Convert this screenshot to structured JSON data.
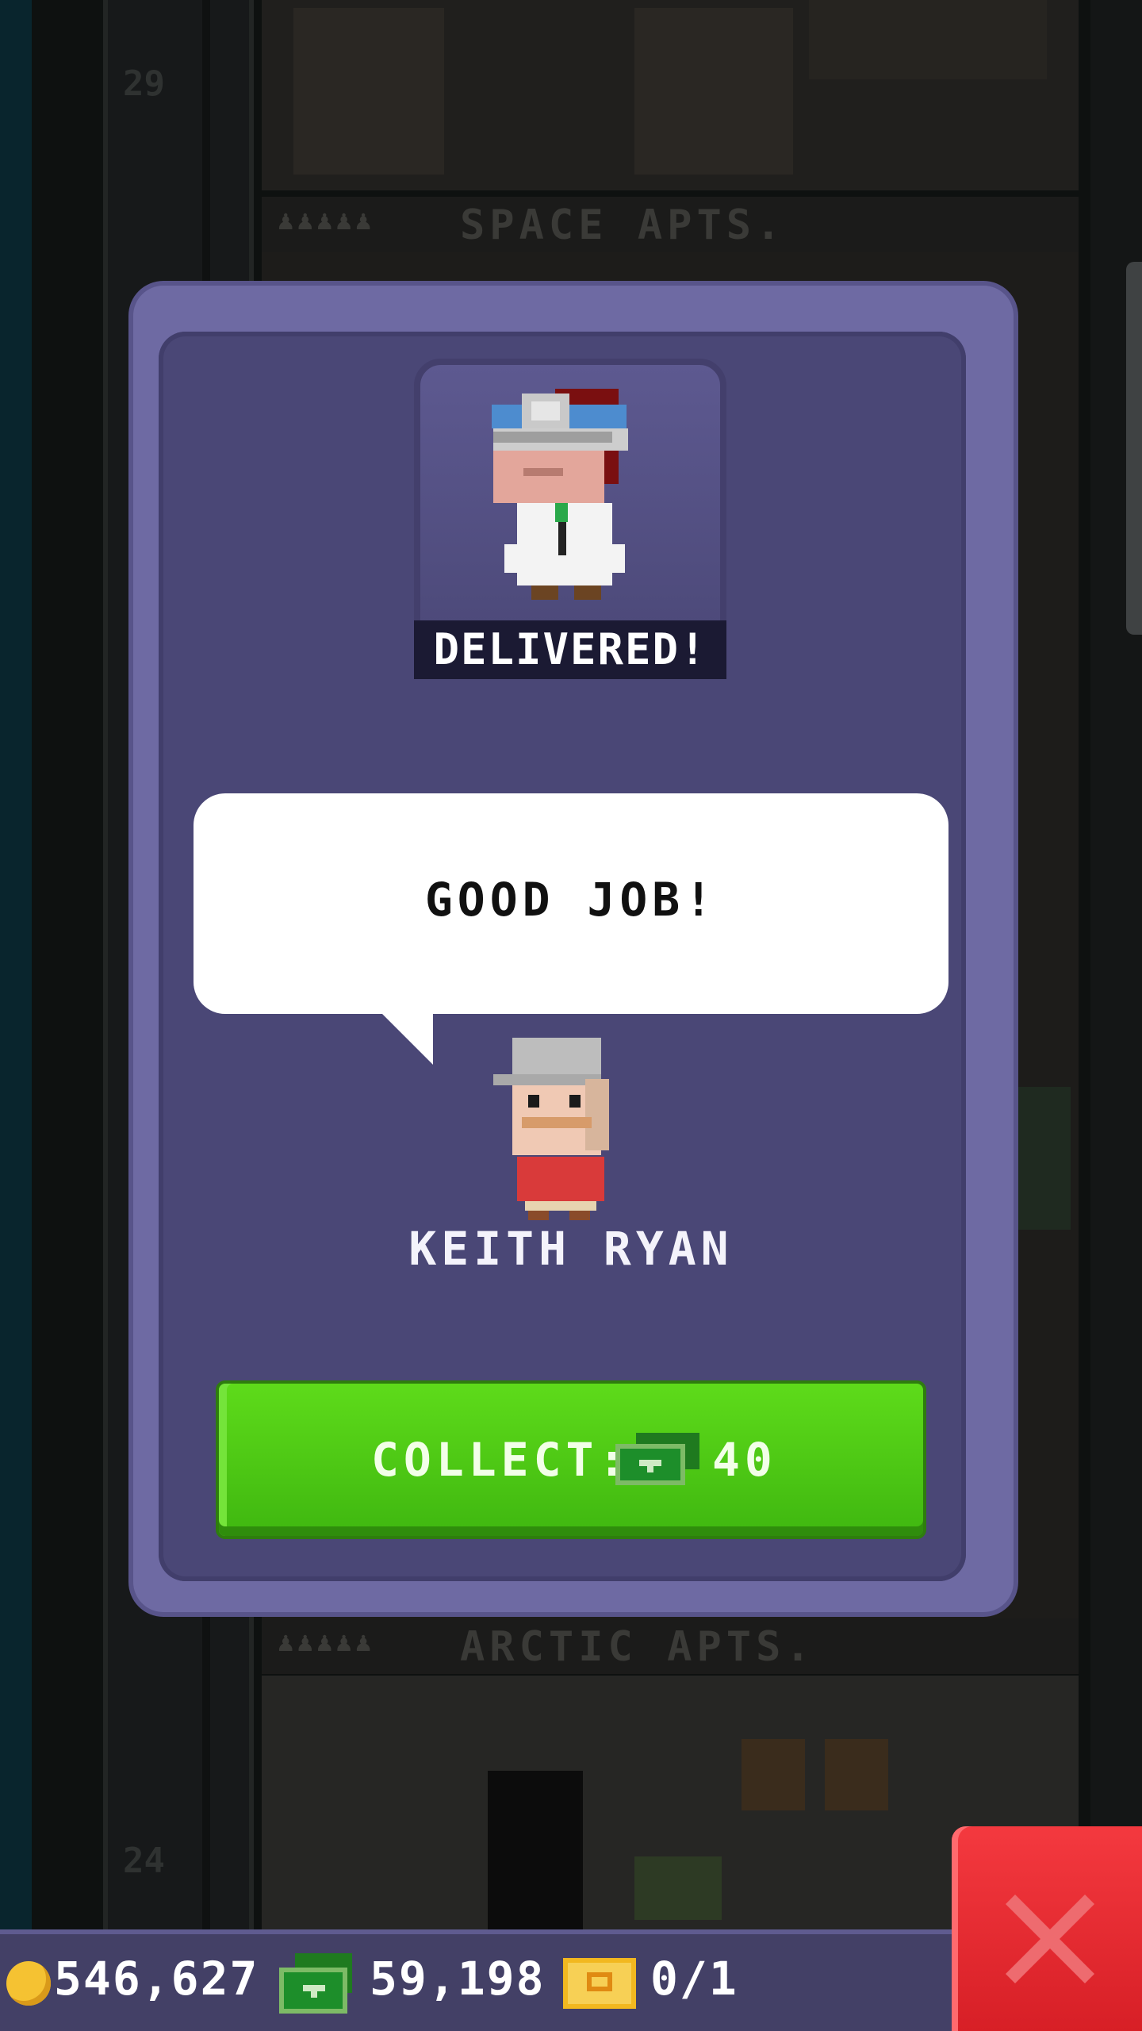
{
  "background": {
    "floors": [
      {
        "number": "29",
        "label": "SPACE APTS."
      },
      {
        "number": "24",
        "label": "ARCTIC APTS."
      }
    ]
  },
  "dialog": {
    "status_banner": "DELIVERED!",
    "speech": "GOOD JOB!",
    "npc_name": "KEITH RYAN",
    "collect": {
      "label": "COLLECT:",
      "amount": "40",
      "currency_icon": "bux-icon"
    }
  },
  "status_bar": {
    "coins": "546,627",
    "bux": "59,198",
    "tickets": "0/1"
  },
  "colors": {
    "dialog_frame": "#6e6aa3",
    "dialog_fill": "#4a4776",
    "collect_green": "#4cc814",
    "close_red": "#e6282e"
  }
}
